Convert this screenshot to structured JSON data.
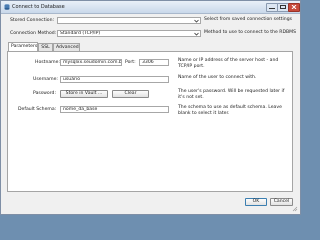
{
  "window": {
    "title": "Connect to Database"
  },
  "stored_connection": {
    "label": "Stored Connection:",
    "value": "",
    "hint": "Select from saved connection settings"
  },
  "connection_method": {
    "label": "Connection Method:",
    "value": "Standard (TCP/IP)",
    "hint": "Method to use to connect to the RDBMS"
  },
  "tabs": [
    {
      "label": "Parameters"
    },
    {
      "label": "SSL"
    },
    {
      "label": "Advanced"
    }
  ],
  "hostname": {
    "label": "Hostname:",
    "value": "mysqlxx.seudomin.com.br",
    "hint": "Name or IP address of the server host - and TCP/IP port."
  },
  "port": {
    "label": "Port:",
    "value": "3306"
  },
  "username": {
    "label": "Username:",
    "value": "usuário",
    "hint": "Name of the user to connect with."
  },
  "password": {
    "label": "Password:",
    "store_button": "Store in Vault ...",
    "clear_button": "Clear",
    "hint": "The user's password. Will be requested later if it's not set."
  },
  "default_schema": {
    "label": "Default Schema:",
    "value": "nome_da_base",
    "hint": "The schema to use as default schema. Leave blank to select it later."
  },
  "footer": {
    "ok": "OK",
    "cancel": "Cancel"
  }
}
